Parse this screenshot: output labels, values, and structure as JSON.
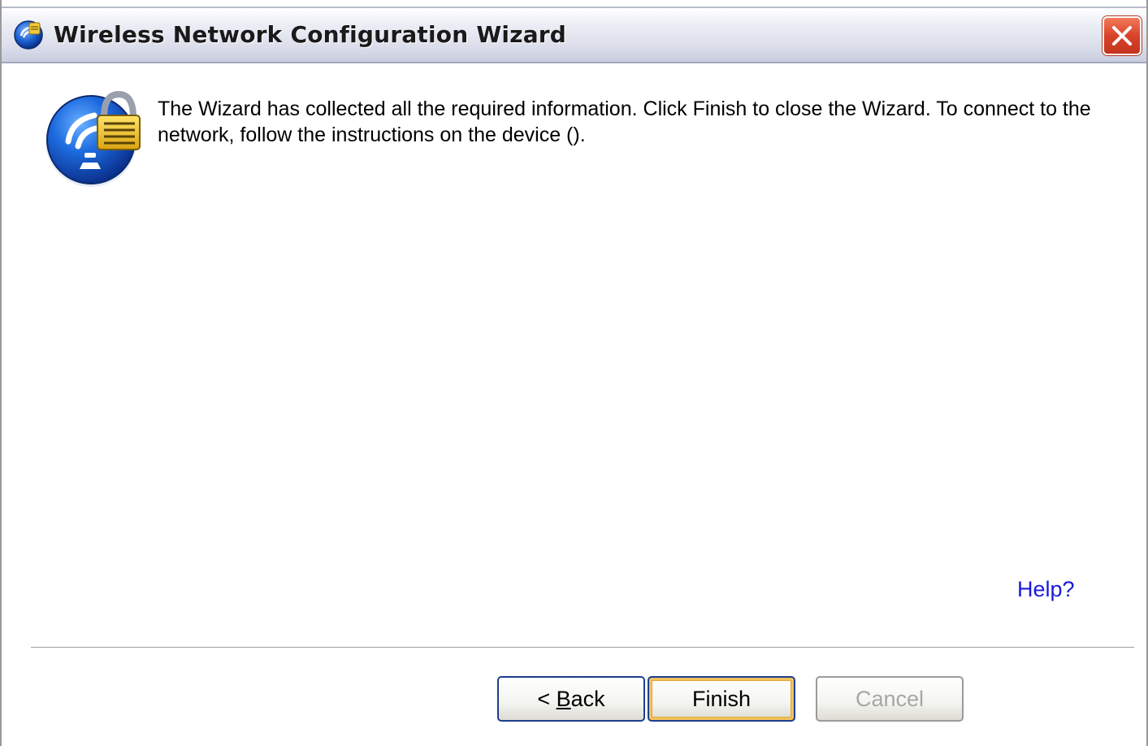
{
  "window": {
    "title": "Wireless Network Configuration Wizard",
    "title_icon": "wireless-globe-icon",
    "close_icon": "close-icon"
  },
  "content": {
    "illustration_icon": "wireless-lock-icon",
    "message": "The Wizard has collected all the required information. Click Finish to close the Wizard. To connect to the network, follow the instructions on the device ().",
    "help_link": "Help?"
  },
  "buttons": {
    "back_prefix": "< ",
    "back_accel": "B",
    "back_rest": "ack",
    "finish": "Finish",
    "cancel": "Cancel",
    "cancel_enabled": false
  },
  "colors": {
    "link": "#1a1adb",
    "close_button": "#d9432a",
    "default_button_highlight": "#f2c25d",
    "disabled_text": "#a7a7a7"
  }
}
